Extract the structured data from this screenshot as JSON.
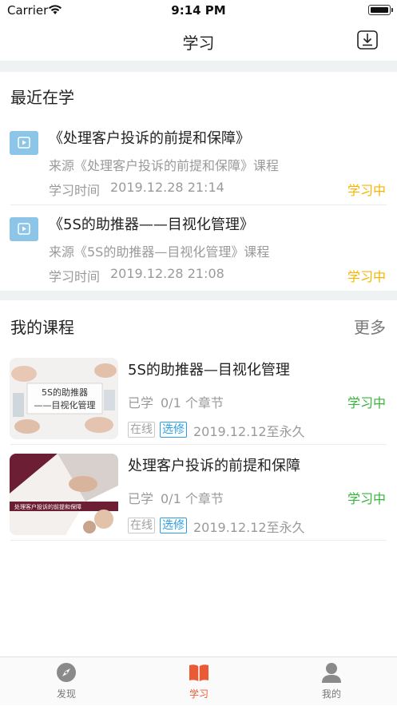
{
  "status_bar": {
    "carrier": "Carrier",
    "time": "9:14 PM"
  },
  "nav": {
    "title": "学习",
    "download_icon": "download-icon"
  },
  "recent": {
    "title": "最近在学",
    "items": [
      {
        "title": "《处理客户投诉的前提和保障》",
        "source": "来源《处理客户投诉的前提和保障》课程",
        "time_label": "学习时间",
        "time": "2019.12.28 21:14",
        "status": "学习中"
      },
      {
        "title": "《5S的助推器——目视化管理》",
        "source": "来源《5S的助推器—目视化管理》课程",
        "time_label": "学习时间",
        "time": "2019.12.28 21:08",
        "status": "学习中"
      }
    ]
  },
  "courses": {
    "title": "我的课程",
    "more": "更多",
    "items": [
      {
        "title": "5S的助推器—目视化管理",
        "progress_label": "已学",
        "progress": "0/1 个章节",
        "status": "学习中",
        "tag_online": "在线",
        "tag_type": "选修",
        "validity": "2019.12.12至永久",
        "thumb_text_1": "5S的助推器",
        "thumb_text_2": "——目视化管理"
      },
      {
        "title": "处理客户投诉的前提和保障",
        "progress_label": "已学",
        "progress": "0/1 个章节",
        "status": "学习中",
        "tag_online": "在线",
        "tag_type": "选修",
        "validity": "2019.12.12至永久",
        "thumb_text_1": "处理客户投诉的前提和保障"
      }
    ]
  },
  "tabs": [
    {
      "label": "发现",
      "icon": "compass-icon",
      "active": false
    },
    {
      "label": "学习",
      "icon": "book-icon",
      "active": true
    },
    {
      "label": "我的",
      "icon": "user-icon",
      "active": false
    }
  ],
  "colors": {
    "accent": "#ea5b35",
    "recent_status": "#f6b400",
    "course_status": "#36b53a",
    "tag_blue": "#2c9de3"
  }
}
